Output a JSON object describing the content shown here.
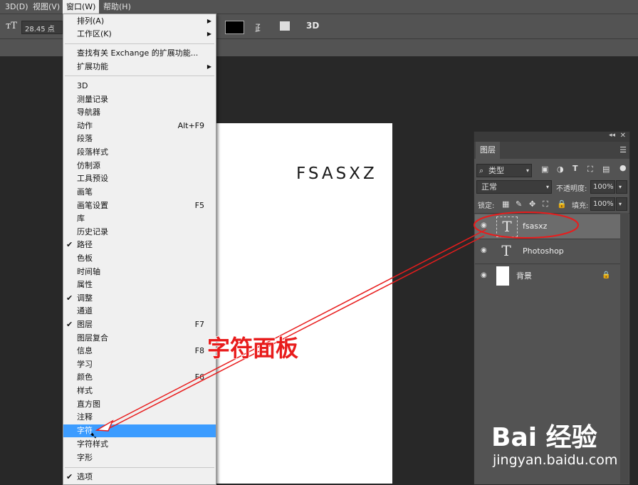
{
  "menubar": {
    "items": [
      "3D(D)",
      "视图(V)",
      "窗口(W)",
      "帮助(H)"
    ]
  },
  "options": {
    "font_size": "28.45 点",
    "tool_3d": "3D"
  },
  "document": {
    "text": "FSASXZ"
  },
  "window_menu": {
    "items": [
      {
        "label": "排列(A)",
        "shortcut": "",
        "checked": false,
        "submenu": true
      },
      {
        "label": "工作区(K)",
        "shortcut": "",
        "checked": false,
        "submenu": true
      },
      {
        "label": "查找有关 Exchange 的扩展功能...",
        "shortcut": "",
        "checked": false,
        "submenu": false
      },
      {
        "label": "扩展功能",
        "shortcut": "",
        "checked": false,
        "submenu": true
      },
      {
        "label": "3D",
        "shortcut": "",
        "checked": false,
        "submenu": false
      },
      {
        "label": "测量记录",
        "shortcut": "",
        "checked": false,
        "submenu": false
      },
      {
        "label": "导航器",
        "shortcut": "",
        "checked": false,
        "submenu": false
      },
      {
        "label": "动作",
        "shortcut": "Alt+F9",
        "checked": false,
        "submenu": false
      },
      {
        "label": "段落",
        "shortcut": "",
        "checked": false,
        "submenu": false
      },
      {
        "label": "段落样式",
        "shortcut": "",
        "checked": false,
        "submenu": false
      },
      {
        "label": "仿制源",
        "shortcut": "",
        "checked": false,
        "submenu": false
      },
      {
        "label": "工具预设",
        "shortcut": "",
        "checked": false,
        "submenu": false
      },
      {
        "label": "画笔",
        "shortcut": "",
        "checked": false,
        "submenu": false
      },
      {
        "label": "画笔设置",
        "shortcut": "F5",
        "checked": false,
        "submenu": false
      },
      {
        "label": "库",
        "shortcut": "",
        "checked": false,
        "submenu": false
      },
      {
        "label": "历史记录",
        "shortcut": "",
        "checked": false,
        "submenu": false
      },
      {
        "label": "路径",
        "shortcut": "",
        "checked": true,
        "submenu": false
      },
      {
        "label": "色板",
        "shortcut": "",
        "checked": false,
        "submenu": false
      },
      {
        "label": "时间轴",
        "shortcut": "",
        "checked": false,
        "submenu": false
      },
      {
        "label": "属性",
        "shortcut": "",
        "checked": false,
        "submenu": false
      },
      {
        "label": "调整",
        "shortcut": "",
        "checked": true,
        "submenu": false
      },
      {
        "label": "通道",
        "shortcut": "",
        "checked": false,
        "submenu": false
      },
      {
        "label": "图层",
        "shortcut": "F7",
        "checked": true,
        "submenu": false
      },
      {
        "label": "图层复合",
        "shortcut": "",
        "checked": false,
        "submenu": false
      },
      {
        "label": "信息",
        "shortcut": "F8",
        "checked": false,
        "submenu": false
      },
      {
        "label": "学习",
        "shortcut": "",
        "checked": false,
        "submenu": false
      },
      {
        "label": "颜色",
        "shortcut": "F6",
        "checked": false,
        "submenu": false
      },
      {
        "label": "样式",
        "shortcut": "",
        "checked": false,
        "submenu": false
      },
      {
        "label": "直方图",
        "shortcut": "",
        "checked": false,
        "submenu": false
      },
      {
        "label": "注释",
        "shortcut": "",
        "checked": false,
        "submenu": false
      },
      {
        "label": "字符",
        "shortcut": "",
        "checked": false,
        "submenu": false,
        "highlighted": true
      },
      {
        "label": "字符样式",
        "shortcut": "",
        "checked": false,
        "submenu": false
      },
      {
        "label": "字形",
        "shortcut": "",
        "checked": false,
        "submenu": false
      },
      {
        "label": "选项",
        "shortcut": "",
        "checked": true,
        "submenu": false
      }
    ]
  },
  "layers_panel": {
    "tab": "图层",
    "filter": "类型",
    "blend_mode": "正常",
    "opacity_label": "不透明度:",
    "opacity": "100%",
    "lock_label": "锁定:",
    "fill_label": "填充:",
    "fill": "100%",
    "layers": [
      {
        "name": "fsasxz",
        "type": "text",
        "selected": true
      },
      {
        "name": "Photoshop",
        "type": "text",
        "selected": false
      },
      {
        "name": "背景",
        "type": "image",
        "selected": false,
        "locked": true
      }
    ]
  },
  "annotation": {
    "text": "字符面板",
    "color": "#e81c1c"
  },
  "watermark": {
    "main": "Bai 经验",
    "sub": "jingyan.baidu.com"
  }
}
